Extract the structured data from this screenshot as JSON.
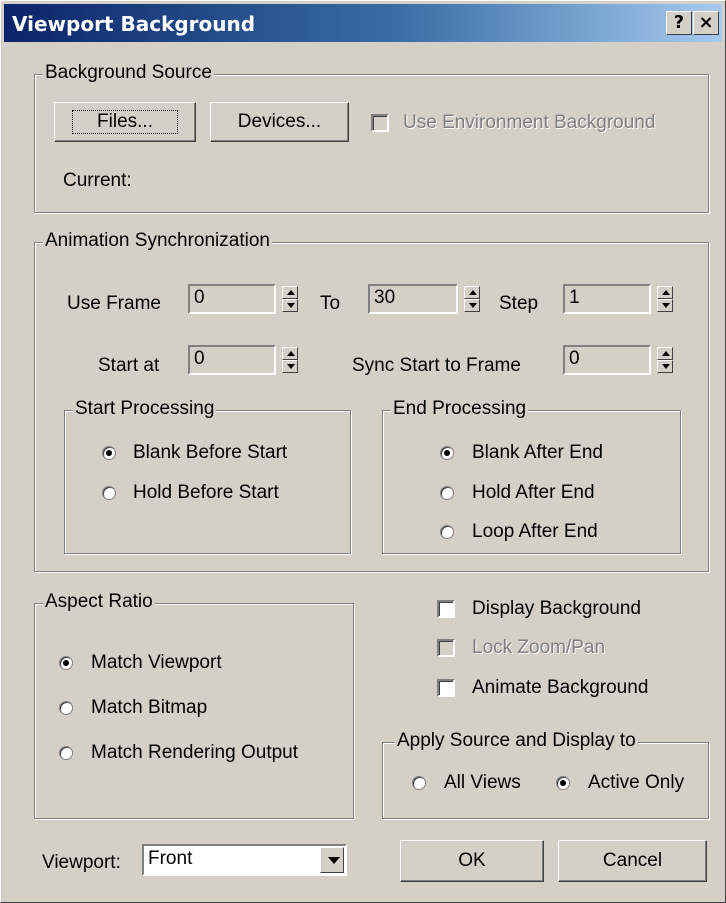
{
  "window": {
    "title": "Viewport Background",
    "help_button": "?",
    "close_button": "×"
  },
  "background_source": {
    "label": "Background Source",
    "files_button": "Files...",
    "devices_button": "Devices...",
    "use_env_label": "Use Environment Background",
    "use_env_checked": false,
    "current_label": "Current:"
  },
  "animation_sync": {
    "label": "Animation Synchronization",
    "use_frame_label": "Use Frame",
    "use_frame_value": "0",
    "to_label": "To",
    "to_value": "30",
    "step_label": "Step",
    "step_value": "1",
    "start_at_label": "Start at",
    "start_at_value": "0",
    "sync_start_label": "Sync Start to Frame",
    "sync_start_value": "0",
    "start_processing": {
      "label": "Start Processing",
      "options": [
        "Blank Before Start",
        "Hold Before Start"
      ],
      "selected": "Blank Before Start"
    },
    "end_processing": {
      "label": "End Processing",
      "options": [
        "Blank After End",
        "Hold After End",
        "Loop After End"
      ],
      "selected": "Blank After End"
    }
  },
  "aspect_ratio": {
    "label": "Aspect Ratio",
    "options": [
      "Match Viewport",
      "Match Bitmap",
      "Match Rendering Output"
    ],
    "selected": "Match Viewport"
  },
  "display": {
    "display_background_label": "Display Background",
    "display_background_checked": false,
    "lock_zoom_label": "Lock Zoom/Pan",
    "lock_zoom_checked": false,
    "animate_background_label": "Animate Background",
    "animate_background_checked": false
  },
  "apply_to": {
    "label": "Apply Source and Display to",
    "options": [
      "All Views",
      "Active Only"
    ],
    "selected": "Active Only"
  },
  "viewport": {
    "label": "Viewport:",
    "value": "Front"
  },
  "buttons": {
    "ok": "OK",
    "cancel": "Cancel"
  }
}
